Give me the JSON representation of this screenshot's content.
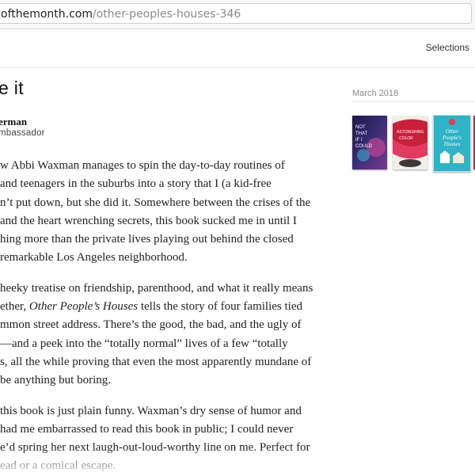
{
  "browser": {
    "url_domain": "ofthemonth.com",
    "url_path": "/other-peoples-houses-346"
  },
  "nav": {
    "selections_label": "Selections"
  },
  "article": {
    "title": "e it",
    "author": "erman",
    "role": "mbassador",
    "paragraphs": [
      [
        "w Abbi Waxman manages to spin the day-to-day routines of",
        " and teenagers in the suburbs into a story that I (a kid-free",
        "n’t put down, but she did it. Somewhere between the crises of the",
        " and the heart wrenching secrets, this book sucked me in until I",
        "hing more than the private lives playing out behind the closed",
        "remarkable Los Angeles neighborhood."
      ],
      [
        "heeky treatise on friendship, parenthood, and what it really means",
        "ether, ",
        "Other People’s Houses",
        " tells the story of four families tied",
        "mmon street address. There’s the good, the bad, and the ugly of",
        "—and a peek into the “totally normal” lives of a few “totally",
        "s, all the while proving that even the most apparently mundane of",
        "be anything but boring."
      ],
      [
        "this book is just plain funny. Waxman’s dry sense of humor and",
        "had me embarrassed to read this book in public; I could never",
        "e’d spring her next laugh-out-loud-worthy line on me. Perfect for",
        "ead or a comical escape."
      ]
    ]
  },
  "sidebar": {
    "month_label": "March 2018",
    "covers": [
      {
        "name": "cover-navy-space",
        "color": "#2a2350",
        "title": "NOT THAT IF I COULD",
        "author": ""
      },
      {
        "name": "cover-astonishing-color",
        "color": "#c41e34",
        "title": "The ASTONISHING COLOR of AFTER",
        "author": ""
      },
      {
        "name": "cover-other-peoples-houses",
        "color": "#2fb3c6",
        "title": "Other People's Houses",
        "author": ""
      },
      {
        "name": "cover-red-partial",
        "color": "#c8243a",
        "title": "",
        "author": ""
      }
    ]
  }
}
